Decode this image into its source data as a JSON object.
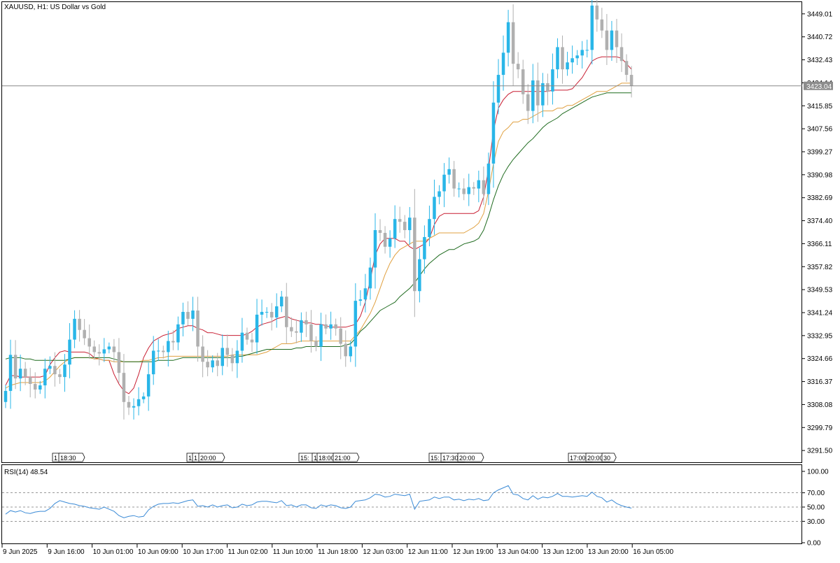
{
  "chart_title": "XAUUSD, H1:  US Dollar vs Gold",
  "current_price_label": "3423.04",
  "indicator_label": "RSI(14) 48.54",
  "colors": {
    "bull": "#29b6e8",
    "bear": "#b0b0b0",
    "ma_fast": "#c81e32",
    "ma_mid": "#e0a040",
    "ma_slow": "#1f6b1f",
    "rsi": "#3a8ad6",
    "level_line": "#777777",
    "price_line": "#888888"
  },
  "chart_data": [
    {
      "type": "candlestick",
      "title": "XAUUSD, H1:  US Dollar vs Gold",
      "price_ticks": [
        "3449.01",
        "3440.72",
        "3432.43",
        "3424.14",
        "3415.85",
        "3407.56",
        "3399.27",
        "3390.98",
        "3382.69",
        "3374.40",
        "3366.11",
        "3357.82",
        "3349.53",
        "3341.24",
        "3332.95",
        "3324.66",
        "3316.37",
        "3308.08",
        "3299.79",
        "3291.50"
      ],
      "x_ticks": [
        "9 Jun 2025",
        "9 Jun 16:00",
        "10 Jun 01:00",
        "10 Jun 09:00",
        "10 Jun 17:00",
        "11 Jun 02:00",
        "11 Jun 10:00",
        "11 Jun 18:00",
        "12 Jun 03:00",
        "12 Jun 11:00",
        "12 Jun 19:00",
        "13 Jun 04:00",
        "13 Jun 12:00",
        "13 Jun 20:00",
        "16 Jun 05:00"
      ],
      "ylim": [
        3287.5,
        3453.0
      ],
      "current_price": 3423.04,
      "event_markers": [
        {
          "text": "1"
        },
        {
          "text": "18:30"
        },
        {
          "text": "1"
        },
        {
          "text": "1"
        },
        {
          "text": "20:00"
        },
        {
          "text": "15:"
        },
        {
          "text": "1"
        },
        {
          "text": "18:00"
        },
        {
          "text": "21:00"
        },
        {
          "text": "15:"
        },
        {
          "text": "17:30"
        },
        {
          "text": "20:00"
        },
        {
          "text": "17:00"
        },
        {
          "text": "20:00"
        },
        {
          "text": "30"
        }
      ],
      "series": [
        {
          "name": "Price",
          "closes": [
            3313.0,
            3326.0,
            3317.5,
            3321.0,
            3318.0,
            3315.5,
            3313.5,
            3315.0,
            3321.0,
            3322.0,
            3319.0,
            3318.0,
            3322.5,
            3331.5,
            3339.0,
            3335.0,
            3332.0,
            3329.0,
            3327.0,
            3326.5,
            3328.0,
            3329.0,
            3327.0,
            3319.5,
            3309.0,
            3307.0,
            3307.5,
            3310.0,
            3311.0,
            3319.0,
            3327.5,
            3327.5,
            3327.0,
            3331.0,
            3330.5,
            3337.0,
            3341.5,
            3339.0,
            3342.0,
            3329.0,
            3323.5,
            3321.5,
            3324.0,
            3322.0,
            3328.5,
            3326.0,
            3323.0,
            3327.5,
            3334.0,
            3331.5,
            3330.5,
            3340.5,
            3341.5,
            3341.5,
            3339.5,
            3343.5,
            3347.0,
            3336.0,
            3334.5,
            3334.0,
            3338.5,
            3337.0,
            3331.0,
            3329.0,
            3337.0,
            3335.5,
            3337.0,
            3335.5,
            3330.0,
            3325.5,
            3329.0,
            3345.5,
            3346.0,
            3350.0,
            3357.5,
            3371.0,
            3370.0,
            3365.0,
            3368.0,
            3375.0,
            3374.0,
            3371.0,
            3375.5,
            3349.0,
            3360.5,
            3368.5,
            3375.0,
            3383.0,
            3385.0,
            3391.0,
            3393.0,
            3386.0,
            3386.0,
            3384.0,
            3386.5,
            3386.0,
            3389.0,
            3384.0,
            3395.0,
            3417.0,
            3427.0,
            3435.0,
            3446.0,
            3431.0,
            3429.0,
            3420.0,
            3414.0,
            3425.0,
            3416.0,
            3424.0,
            3421.0,
            3429.0,
            3437.0,
            3429.0,
            3431.5,
            3433.0,
            3434.0,
            3436.0,
            3436.0,
            3452.0,
            3447.0,
            3443.0,
            3436.0,
            3443.0,
            3437.0,
            3432.0,
            3427.0,
            3423.04
          ]
        },
        {
          "name": "MA fast",
          "values": [
            3315.0,
            3318.5,
            3318.5,
            3318.0,
            3318.0,
            3318.0,
            3318.0,
            3318.0,
            3318.5,
            3322.5,
            3325.0,
            3327.0,
            3327.5,
            3327.0,
            3327.0,
            3327.0,
            3327.0,
            3326.5,
            3325.0,
            3324.5,
            3324.0,
            3324.0,
            3319.0,
            3315.5,
            3313.0,
            3312.0,
            3314.0,
            3319.0,
            3325.0,
            3328.5,
            3331.0,
            3332.0,
            3333.0,
            3333.5,
            3334.0,
            3335.5,
            3336.0,
            3336.5,
            3336.5,
            3335.5,
            3335.0,
            3334.0,
            3334.0,
            3333.5,
            3333.0,
            3333.0,
            3333.0,
            3333.0,
            3333.0,
            3333.5,
            3334.5,
            3336.0,
            3337.0,
            3337.5,
            3338.0,
            3339.0,
            3339.5,
            3340.0,
            3339.0,
            3338.5,
            3338.0,
            3337.5,
            3337.5,
            3337.0,
            3337.0,
            3336.5,
            3336.0,
            3336.0,
            3336.0,
            3336.0,
            3336.5,
            3337.0,
            3340.0,
            3345.0,
            3353.0,
            3362.0,
            3366.0,
            3368.0,
            3368.0,
            3368.0,
            3367.0,
            3367.0,
            3365.0,
            3364.0,
            3365.0,
            3366.0,
            3368.0,
            3373.0,
            3376.0,
            3377.0,
            3377.0,
            3377.0,
            3377.0,
            3377.0,
            3377.0,
            3377.0,
            3378.0,
            3383.0,
            3393.0,
            3407.0,
            3415.0,
            3418.0,
            3420.0,
            3421.0,
            3421.0,
            3421.0,
            3421.0,
            3421.0,
            3421.0,
            3421.0,
            3421.0,
            3421.5,
            3421.5,
            3421.5,
            3421.5,
            3422.0,
            3424.0,
            3426.0,
            3429.0,
            3432.0,
            3433.0,
            3433.5,
            3433.5,
            3433.5,
            3433.5,
            3433.0,
            3431.0,
            3429.0
          ]
        },
        {
          "name": "MA mid",
          "values": [
            3314.0,
            3315.0,
            3315.5,
            3316.0,
            3316.0,
            3316.0,
            3316.0,
            3316.0,
            3316.5,
            3318.0,
            3320.0,
            3322.0,
            3323.5,
            3324.5,
            3325.0,
            3325.0,
            3325.0,
            3325.0,
            3324.5,
            3324.5,
            3324.0,
            3324.0,
            3323.5,
            3323.5,
            3323.5,
            3323.5,
            3323.5,
            3323.5,
            3324.0,
            3324.0,
            3324.5,
            3325.0,
            3325.0,
            3325.5,
            3325.5,
            3325.5,
            3325.5,
            3325.5,
            3325.5,
            3325.5,
            3325.5,
            3325.5,
            3325.5,
            3325.5,
            3325.5,
            3325.5,
            3326.0,
            3326.0,
            3326.0,
            3326.0,
            3326.0,
            3326.0,
            3326.5,
            3327.0,
            3328.0,
            3329.0,
            3330.0,
            3330.0,
            3330.0,
            3330.5,
            3331.0,
            3331.0,
            3331.0,
            3331.0,
            3331.0,
            3331.0,
            3331.0,
            3331.0,
            3331.0,
            3331.0,
            3331.0,
            3333.0,
            3335.0,
            3338.0,
            3341.0,
            3345.0,
            3350.0,
            3355.0,
            3359.0,
            3362.0,
            3364.0,
            3365.0,
            3366.0,
            3367.0,
            3367.0,
            3367.0,
            3368.0,
            3369.0,
            3370.0,
            3370.0,
            3370.0,
            3370.0,
            3370.0,
            3370.0,
            3371.0,
            3372.0,
            3373.5,
            3377.0,
            3385.0,
            3395.0,
            3403.0,
            3406.5,
            3408.0,
            3410.0,
            3410.0,
            3411.0,
            3411.0,
            3412.0,
            3413.0,
            3414.0,
            3414.0,
            3414.0,
            3415.0,
            3415.0,
            3416.0,
            3416.0,
            3417.0,
            3418.0,
            3419.0,
            3420.0,
            3421.0,
            3421.0,
            3421.0,
            3422.0,
            3423.0,
            3424.0,
            3424.0,
            3424.0
          ]
        },
        {
          "name": "MA slow",
          "values": [
            3324.5,
            3325.0,
            3325.0,
            3325.0,
            3324.5,
            3324.5,
            3324.0,
            3324.0,
            3324.0,
            3324.0,
            3324.0,
            3324.0,
            3324.0,
            3324.5,
            3325.0,
            3325.0,
            3325.0,
            3325.0,
            3325.0,
            3325.0,
            3325.0,
            3325.0,
            3324.5,
            3324.0,
            3323.5,
            3323.5,
            3323.5,
            3323.5,
            3323.5,
            3323.5,
            3323.5,
            3324.0,
            3324.0,
            3324.0,
            3324.0,
            3324.5,
            3325.0,
            3325.0,
            3325.0,
            3325.0,
            3325.0,
            3325.0,
            3325.0,
            3325.0,
            3325.0,
            3325.0,
            3325.0,
            3325.5,
            3325.5,
            3326.0,
            3326.5,
            3327.0,
            3327.5,
            3328.0,
            3328.0,
            3328.0,
            3328.0,
            3328.0,
            3328.0,
            3328.5,
            3328.5,
            3329.0,
            3329.0,
            3329.0,
            3329.0,
            3329.0,
            3329.0,
            3329.0,
            3329.0,
            3329.5,
            3330.0,
            3332.0,
            3334.5,
            3336.0,
            3338.0,
            3340.0,
            3342.0,
            3343.0,
            3344.0,
            3345.0,
            3347.0,
            3348.5,
            3350.0,
            3352.0,
            3354.5,
            3357.0,
            3359.0,
            3360.5,
            3362.0,
            3363.0,
            3364.0,
            3364.0,
            3365.0,
            3366.0,
            3366.5,
            3367.0,
            3368.0,
            3371.0,
            3376.0,
            3382.0,
            3387.0,
            3391.0,
            3394.0,
            3396.5,
            3398.5,
            3400.5,
            3402.5,
            3404.0,
            3406.0,
            3408.0,
            3409.5,
            3410.5,
            3411.5,
            3413.0,
            3414.0,
            3415.0,
            3416.0,
            3417.0,
            3418.0,
            3419.0,
            3419.5,
            3420.0,
            3420.5,
            3420.5,
            3420.5,
            3420.5,
            3420.5,
            3420.5
          ]
        }
      ]
    },
    {
      "type": "line",
      "title": "RSI(14) 48.54",
      "y_ticks": [
        "100.00",
        "70.00",
        "50.00",
        "30.00",
        "0.00"
      ],
      "levels": [
        70,
        50,
        30
      ],
      "ylim": [
        0,
        100
      ],
      "series": [
        {
          "name": "RSI(14)",
          "values": [
            40,
            45,
            43,
            45,
            42,
            41,
            43,
            44,
            44,
            48,
            55,
            59,
            57,
            55,
            54,
            52,
            51,
            49,
            48,
            47,
            50,
            47,
            44,
            38,
            35,
            37,
            38,
            36,
            37,
            46,
            51,
            54,
            55,
            55,
            56,
            55,
            57,
            59,
            60,
            51,
            52,
            50,
            53,
            50,
            52,
            53,
            49,
            50,
            54,
            52,
            53,
            57,
            58,
            58,
            57,
            56,
            59,
            52,
            53,
            50,
            53,
            53,
            49,
            48,
            53,
            51,
            53,
            52,
            49,
            48,
            50,
            58,
            59,
            60,
            63,
            68,
            67,
            64,
            65,
            68,
            67,
            66,
            68,
            47,
            58,
            59,
            60,
            64,
            62,
            64,
            64,
            60,
            61,
            59,
            61,
            60,
            62,
            59,
            60,
            70,
            74,
            77,
            80,
            68,
            67,
            62,
            60,
            66,
            61,
            64,
            63,
            65,
            69,
            65,
            65,
            64,
            65,
            66,
            65,
            71,
            65,
            63,
            57,
            60,
            55,
            52,
            50,
            48.54
          ]
        }
      ]
    }
  ]
}
